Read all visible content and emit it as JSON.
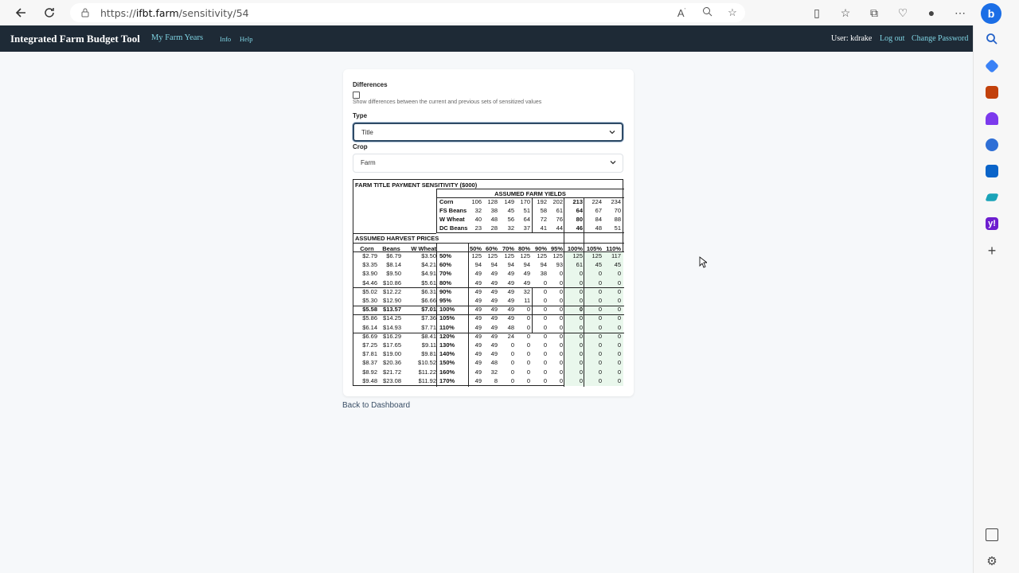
{
  "browser": {
    "url_prefix": "https://",
    "url_host": "ifbt.farm",
    "url_path": "/sensitivity/54"
  },
  "header": {
    "brand": "Integrated Farm Budget Tool",
    "links": [
      "My Farm Years",
      "Info",
      "Help"
    ],
    "user_label": "User: kdrake",
    "logout": "Log out",
    "change_password": "Change Password"
  },
  "form": {
    "differences_label": "Differences",
    "differences_checked": false,
    "differences_help": "Show differences between the current and previous sets of sensitized values",
    "type_label": "Type",
    "type_value": "Title",
    "crop_label": "Crop",
    "crop_value": "Farm"
  },
  "table": {
    "title": "FARM TITLE PAYMENT SENSITIVITY ($000)",
    "yields_header": "ASSUMED FARM YIELDS",
    "prices_header": "ASSUMED HARVEST PRICES",
    "yield_rows": [
      {
        "crop": "Corn",
        "values": [
          "106",
          "128",
          "149",
          "170",
          "192",
          "202",
          "213",
          "224",
          "234"
        ]
      },
      {
        "crop": "FS Beans",
        "values": [
          "32",
          "38",
          "45",
          "51",
          "58",
          "61",
          "64",
          "67",
          "70"
        ]
      },
      {
        "crop": "W Wheat",
        "values": [
          "40",
          "48",
          "56",
          "64",
          "72",
          "76",
          "80",
          "84",
          "88"
        ]
      },
      {
        "crop": "DC Beans",
        "values": [
          "23",
          "28",
          "32",
          "37",
          "41",
          "44",
          "46",
          "48",
          "51"
        ]
      }
    ],
    "price_cols": [
      "Corn",
      "Beans",
      "W Wheat"
    ],
    "yield_pcts": [
      "50%",
      "60%",
      "70%",
      "80%",
      "90%",
      "95%",
      "100%",
      "105%",
      "110%"
    ],
    "rows": [
      {
        "corn": "$2.79",
        "beans": "$6.79",
        "wheat": "$3.50",
        "pct": "50%",
        "values": [
          "125",
          "125",
          "125",
          "125",
          "125",
          "125",
          "125",
          "125",
          "117"
        ]
      },
      {
        "corn": "$3.35",
        "beans": "$8.14",
        "wheat": "$4.21",
        "pct": "60%",
        "values": [
          "94",
          "94",
          "94",
          "94",
          "94",
          "93",
          "61",
          "45",
          "45"
        ]
      },
      {
        "corn": "$3.90",
        "beans": "$9.50",
        "wheat": "$4.91",
        "pct": "70%",
        "values": [
          "49",
          "49",
          "49",
          "49",
          "38",
          "0",
          "0",
          "0",
          "0"
        ]
      },
      {
        "corn": "$4.46",
        "beans": "$10.86",
        "wheat": "$5.61",
        "pct": "80%",
        "values": [
          "49",
          "49",
          "49",
          "49",
          "0",
          "0",
          "0",
          "0",
          "0"
        ]
      },
      {
        "corn": "$5.02",
        "beans": "$12.22",
        "wheat": "$6.31",
        "pct": "90%",
        "values": [
          "49",
          "49",
          "49",
          "32",
          "0",
          "0",
          "0",
          "0",
          "0"
        ]
      },
      {
        "corn": "$5.30",
        "beans": "$12.90",
        "wheat": "$6.66",
        "pct": "95%",
        "values": [
          "49",
          "49",
          "49",
          "11",
          "0",
          "0",
          "0",
          "0",
          "0"
        ]
      },
      {
        "corn": "$5.58",
        "beans": "$13.57",
        "wheat": "$7.01",
        "pct": "100%",
        "values": [
          "49",
          "49",
          "49",
          "0",
          "0",
          "0",
          "0",
          "0",
          "0"
        ]
      },
      {
        "corn": "$5.86",
        "beans": "$14.25",
        "wheat": "$7.36",
        "pct": "105%",
        "values": [
          "49",
          "49",
          "49",
          "0",
          "0",
          "0",
          "0",
          "0",
          "0"
        ]
      },
      {
        "corn": "$6.14",
        "beans": "$14.93",
        "wheat": "$7.71",
        "pct": "110%",
        "values": [
          "49",
          "49",
          "48",
          "0",
          "0",
          "0",
          "0",
          "0",
          "0"
        ]
      },
      {
        "corn": "$6.69",
        "beans": "$16.29",
        "wheat": "$8.41",
        "pct": "120%",
        "values": [
          "49",
          "49",
          "24",
          "0",
          "0",
          "0",
          "0",
          "0",
          "0"
        ]
      },
      {
        "corn": "$7.25",
        "beans": "$17.65",
        "wheat": "$9.11",
        "pct": "130%",
        "values": [
          "49",
          "49",
          "0",
          "0",
          "0",
          "0",
          "0",
          "0",
          "0"
        ]
      },
      {
        "corn": "$7.81",
        "beans": "$19.00",
        "wheat": "$9.81",
        "pct": "140%",
        "values": [
          "49",
          "49",
          "0",
          "0",
          "0",
          "0",
          "0",
          "0",
          "0"
        ]
      },
      {
        "corn": "$8.37",
        "beans": "$20.36",
        "wheat": "$10.52",
        "pct": "150%",
        "values": [
          "49",
          "48",
          "0",
          "0",
          "0",
          "0",
          "0",
          "0",
          "0"
        ]
      },
      {
        "corn": "$8.92",
        "beans": "$21.72",
        "wheat": "$11.22",
        "pct": "160%",
        "values": [
          "49",
          "32",
          "0",
          "0",
          "0",
          "0",
          "0",
          "0",
          "0"
        ]
      },
      {
        "corn": "$9.48",
        "beans": "$23.08",
        "wheat": "$11.92",
        "pct": "170%",
        "values": [
          "49",
          "8",
          "0",
          "0",
          "0",
          "0",
          "0",
          "0",
          "0"
        ]
      }
    ]
  },
  "back_link": "Back to Dashboard"
}
